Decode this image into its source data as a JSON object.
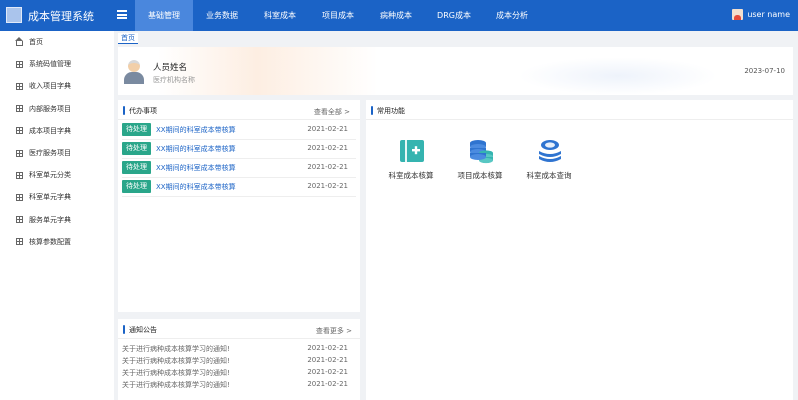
{
  "app": {
    "title": "成本管理系统"
  },
  "nav": {
    "items": [
      {
        "label": "基础管理"
      },
      {
        "label": "业务数据"
      },
      {
        "label": "科室成本"
      },
      {
        "label": "项目成本"
      },
      {
        "label": "病种成本"
      },
      {
        "label": "DRG成本"
      },
      {
        "label": "成本分析"
      }
    ],
    "active": "基础管理"
  },
  "user": {
    "name": "user name"
  },
  "sidebar": {
    "items": [
      {
        "label": "首页",
        "icon": "home-icon"
      },
      {
        "label": "系统码值管理",
        "icon": "grid-icon"
      },
      {
        "label": "收入项目字典",
        "icon": "grid-icon"
      },
      {
        "label": "内部服务项目",
        "icon": "grid-icon"
      },
      {
        "label": "成本项目字典",
        "icon": "grid-icon"
      },
      {
        "label": "医疗服务项目",
        "icon": "grid-icon"
      },
      {
        "label": "科室单元分类",
        "icon": "grid-icon"
      },
      {
        "label": "科室单元字典",
        "icon": "grid-icon"
      },
      {
        "label": "服务单元字典",
        "icon": "grid-icon"
      },
      {
        "label": "核算参数配置",
        "icon": "grid-icon"
      }
    ]
  },
  "breadcrumb": {
    "current": "首页"
  },
  "profile": {
    "name": "人员姓名",
    "org": "医疗机构名称",
    "date": "2023-07-10"
  },
  "todo": {
    "title": "代办事项",
    "more": "查看全部 >",
    "items": [
      {
        "tag": "待处理",
        "text": "XX期间的科室成本带核算",
        "date": "2021-02-21"
      },
      {
        "tag": "待处理",
        "text": "XX期间的科室成本带核算",
        "date": "2021-02-21"
      },
      {
        "tag": "待处理",
        "text": "XX期间的科室成本带核算",
        "date": "2021-02-21"
      },
      {
        "tag": "待处理",
        "text": "XX期间的科室成本带核算",
        "date": "2021-02-21"
      }
    ],
    "tag_color": "#2aa68a"
  },
  "common": {
    "title": "常用功能",
    "items": [
      {
        "label": "科室成本核算",
        "icon": "dept-cost-icon"
      },
      {
        "label": "项目成本核算",
        "icon": "coin-stack-icon"
      },
      {
        "label": "科室成本查询",
        "icon": "coin-query-icon"
      }
    ]
  },
  "notice": {
    "title": "通知公告",
    "more": "查看更多 >",
    "items": [
      {
        "text": "关于进行病种成本核算学习的通知!",
        "date": "2021-02-21"
      },
      {
        "text": "关于进行病种成本核算学习的通知!",
        "date": "2021-02-21"
      },
      {
        "text": "关于进行病种成本核算学习的通知!",
        "date": "2021-02-21"
      },
      {
        "text": "关于进行病种成本核算学习的通知!",
        "date": "2021-02-21"
      }
    ]
  },
  "colors": {
    "primary": "#1b63c6",
    "nav_active": "#4a87dd",
    "accent": "#2aa68a"
  }
}
